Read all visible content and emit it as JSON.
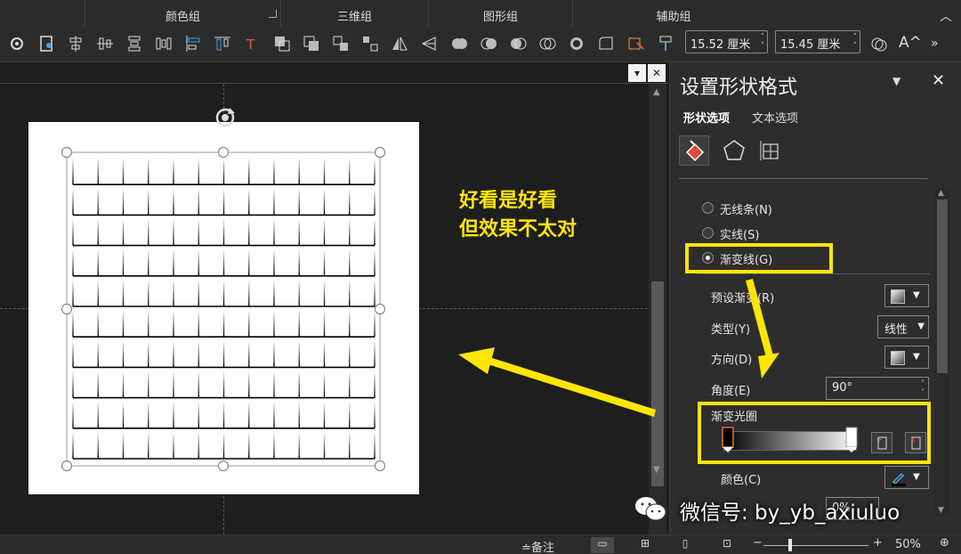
{
  "ribbon": {
    "groups": [
      {
        "label": ""
      },
      {
        "label": "颜色组"
      },
      {
        "label": "三维组"
      },
      {
        "label": "图形组"
      },
      {
        "label": "辅助组"
      }
    ],
    "height_value": "15.52 厘米",
    "width_value": "15.45 厘米",
    "more": "»",
    "font_size_up": "A^"
  },
  "annotation": {
    "line1": "好看是好看",
    "line2": "但效果不太对",
    "color": "#ffe600"
  },
  "panel": {
    "title": "设置形状格式",
    "tab_shape": "形状选项",
    "tab_text": "文本选项",
    "line_options": [
      {
        "label": "无线条(N)",
        "selected": false
      },
      {
        "label": "实线(S)",
        "selected": false
      },
      {
        "label": "渐变线(G)",
        "selected": true
      }
    ],
    "preset_label": "预设渐变(R)",
    "type_label": "类型(Y)",
    "type_value": "线性",
    "direction_label": "方向(D)",
    "angle_label": "角度(E)",
    "angle_value": "90°",
    "stops_label": "渐变光圈",
    "color_label": "颜色(C)",
    "position_value": "0%"
  },
  "watermark": {
    "text": "微信号: by_yb_axiuluo"
  },
  "status": {
    "notes": "≐备注",
    "zoom_minus": "−",
    "zoom_plus": "+",
    "zoom": "50%",
    "zoom_fraction": 0.25
  },
  "slide": {
    "rows": 10,
    "cols": 12
  }
}
